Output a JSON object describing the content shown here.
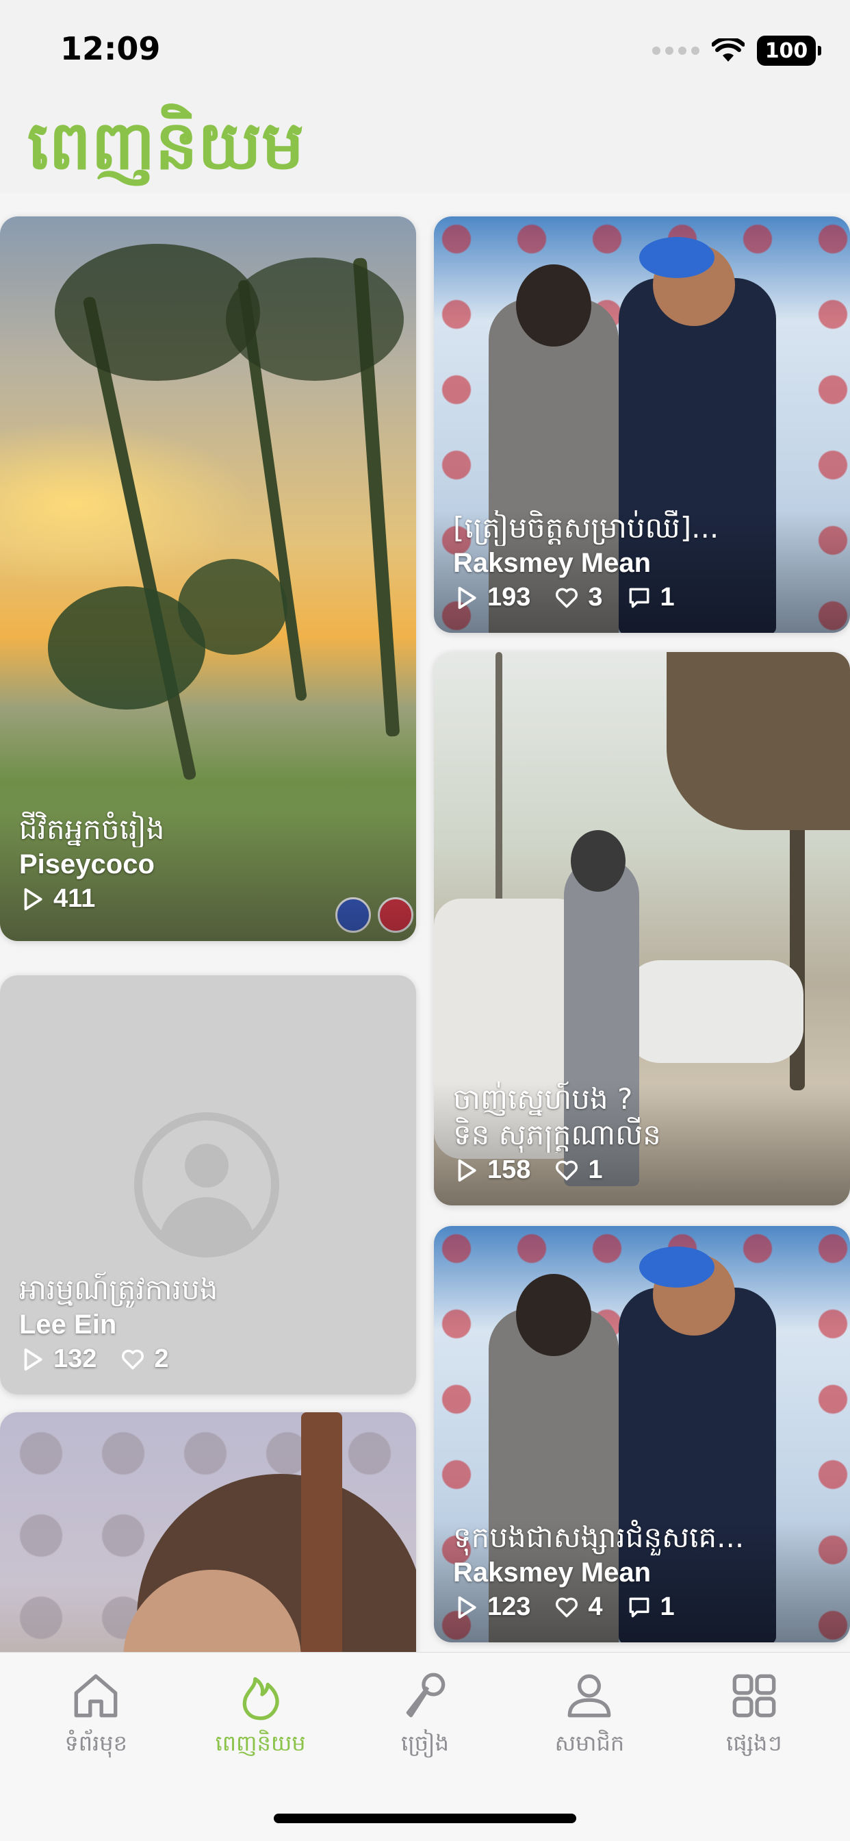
{
  "status": {
    "time": "12:09",
    "battery": "100"
  },
  "header": {
    "title": "ពេញនិយម"
  },
  "feed": {
    "cards": [
      {
        "title": "ជីវិតអ្នកចំរៀង",
        "author": "Piseycoco",
        "plays": "411"
      },
      {
        "title": "[ត្រៀមចិត្តសម្រាប់ឈឺ]...",
        "author": "Raksmey Mean",
        "plays": "193",
        "likes": "3",
        "comments": "1"
      },
      {
        "title": "ចាញ់ស្នេហ៍បង ?",
        "author": "ទិន សុភក្រ្តណាលីន",
        "plays": "158",
        "likes": "1"
      },
      {
        "title": "អារម្មណ៍ត្រូវការបង",
        "author": "Lee Ein",
        "plays": "132",
        "likes": "2"
      },
      {
        "title": "ទុកបងជាសង្សារជំនួសគេ...",
        "author": "Raksmey Mean",
        "plays": "123",
        "likes": "4",
        "comments": "1"
      }
    ]
  },
  "tabbar": {
    "items": [
      {
        "label": "ទំព័រមុខ",
        "icon": "home-icon"
      },
      {
        "label": "ពេញនិយម",
        "icon": "flame-icon",
        "active": true
      },
      {
        "label": "ច្រៀង",
        "icon": "microphone-icon"
      },
      {
        "label": "សមាជិក",
        "icon": "user-icon"
      },
      {
        "label": "ផ្សេងៗ",
        "icon": "grid-icon"
      }
    ]
  },
  "colors": {
    "accent": "#8bc34a",
    "inactive": "#8e8e93"
  }
}
